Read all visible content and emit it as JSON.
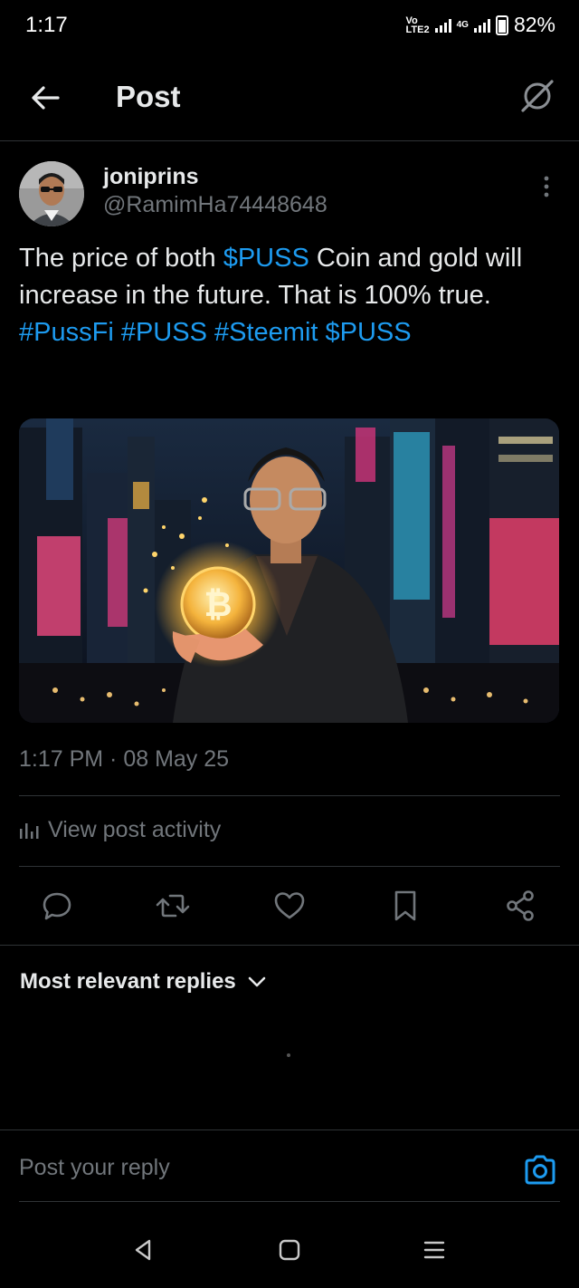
{
  "status_bar": {
    "time": "1:17",
    "volte_line1": "Vo",
    "volte_line2": "LTE2",
    "network_type": "4G",
    "battery_percent": "82%",
    "battery_level": 0.82
  },
  "top_bar": {
    "title": "Post",
    "back_icon": "arrow-left-icon",
    "grok_icon": "grok-icon"
  },
  "post": {
    "author_name": "joniprins",
    "author_handle": "@RamimHa74448648",
    "text_part1": "The price of both ",
    "cashtag1": "$PUSS",
    "text_part2": " Coin and gold will increase in the future. That is 100% true.",
    "hashtags": [
      "#PussFi",
      "#PUSS",
      "#Steemit",
      "$PUSS"
    ],
    "timestamp": "1:17 PM · 08 May 25",
    "view_activity_label": "View post activity"
  },
  "actions": [
    {
      "name": "reply-icon"
    },
    {
      "name": "repost-icon"
    },
    {
      "name": "like-icon"
    },
    {
      "name": "bookmark-icon"
    },
    {
      "name": "share-icon"
    }
  ],
  "replies": {
    "sort_label": "Most relevant replies"
  },
  "composer": {
    "placeholder": "Post your reply"
  },
  "colors": {
    "background": "#000000",
    "text": "#e7e9ea",
    "secondary": "#71767b",
    "link": "#1d9bf0",
    "divider": "#2f3336"
  }
}
